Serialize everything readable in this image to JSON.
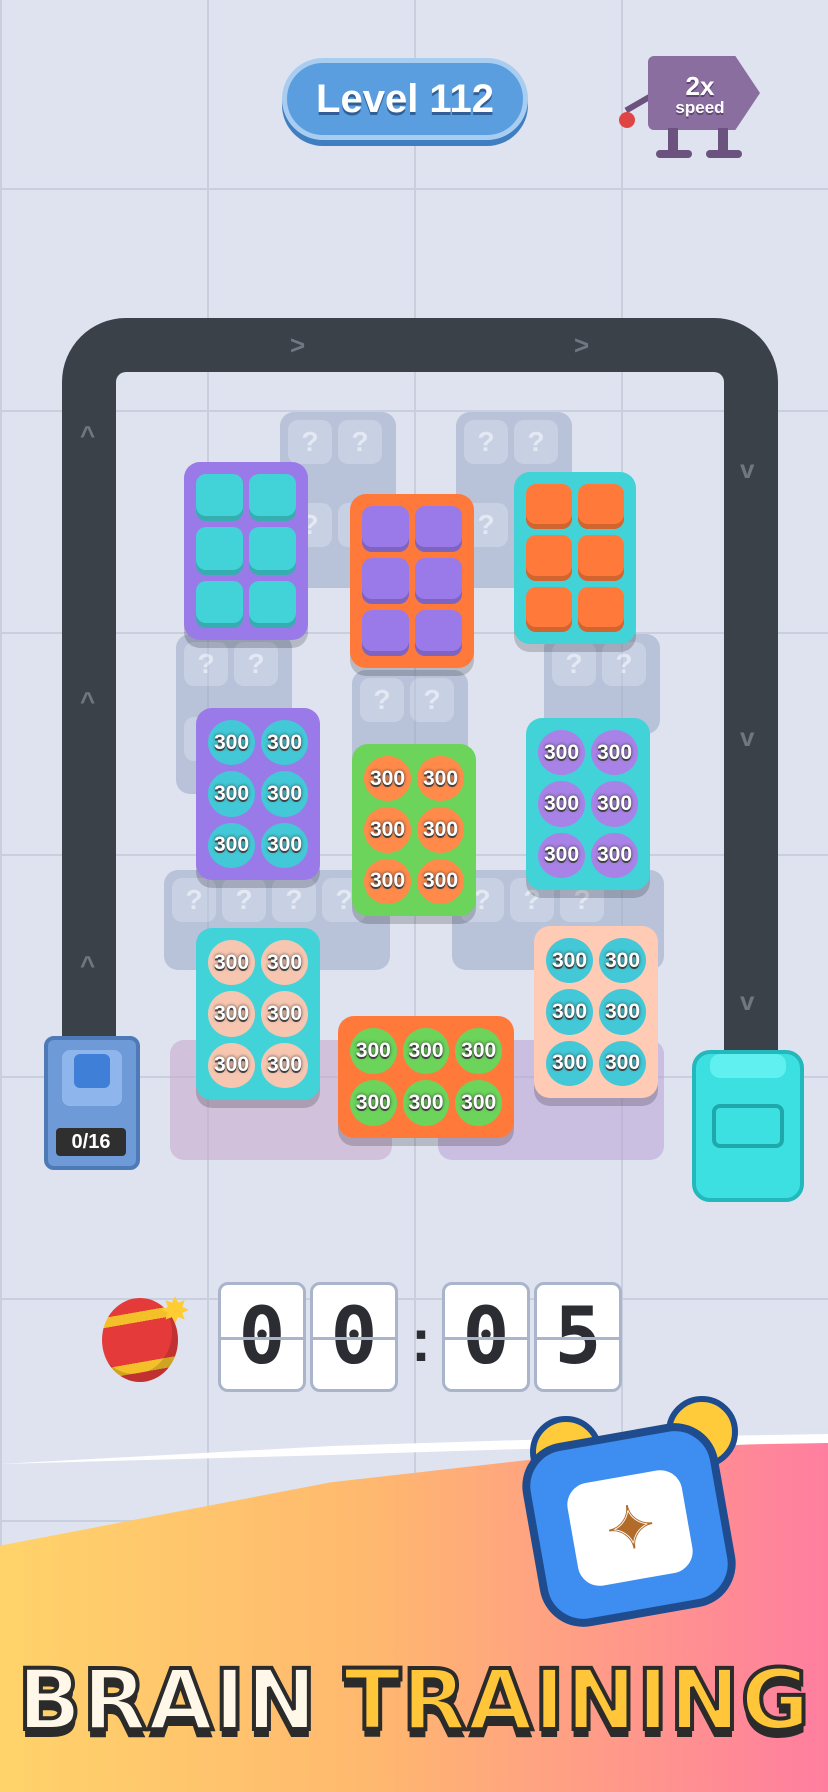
{
  "header": {
    "level_label": "Level 112",
    "speed_multiplier": "2x",
    "speed_label": "speed"
  },
  "board": {
    "track_arrows": [
      ">",
      ">",
      "^",
      "^",
      "^",
      "v",
      "v",
      "v"
    ],
    "ghost_symbol": "?",
    "bomb_value": "300",
    "dispenser_counter": "0/16",
    "colors": {
      "teal": "#42d3d8",
      "purple": "#9a7ae8",
      "orange": "#ff7a3a",
      "green": "#6cd45a",
      "peach": "#ffcbb4",
      "dark_track": "#3b4149"
    }
  },
  "timer": {
    "digits": [
      "0",
      "0",
      "0",
      "5"
    ],
    "separator": ":"
  },
  "banner": {
    "word1": "BRAIN",
    "word2": "TRAINING"
  }
}
